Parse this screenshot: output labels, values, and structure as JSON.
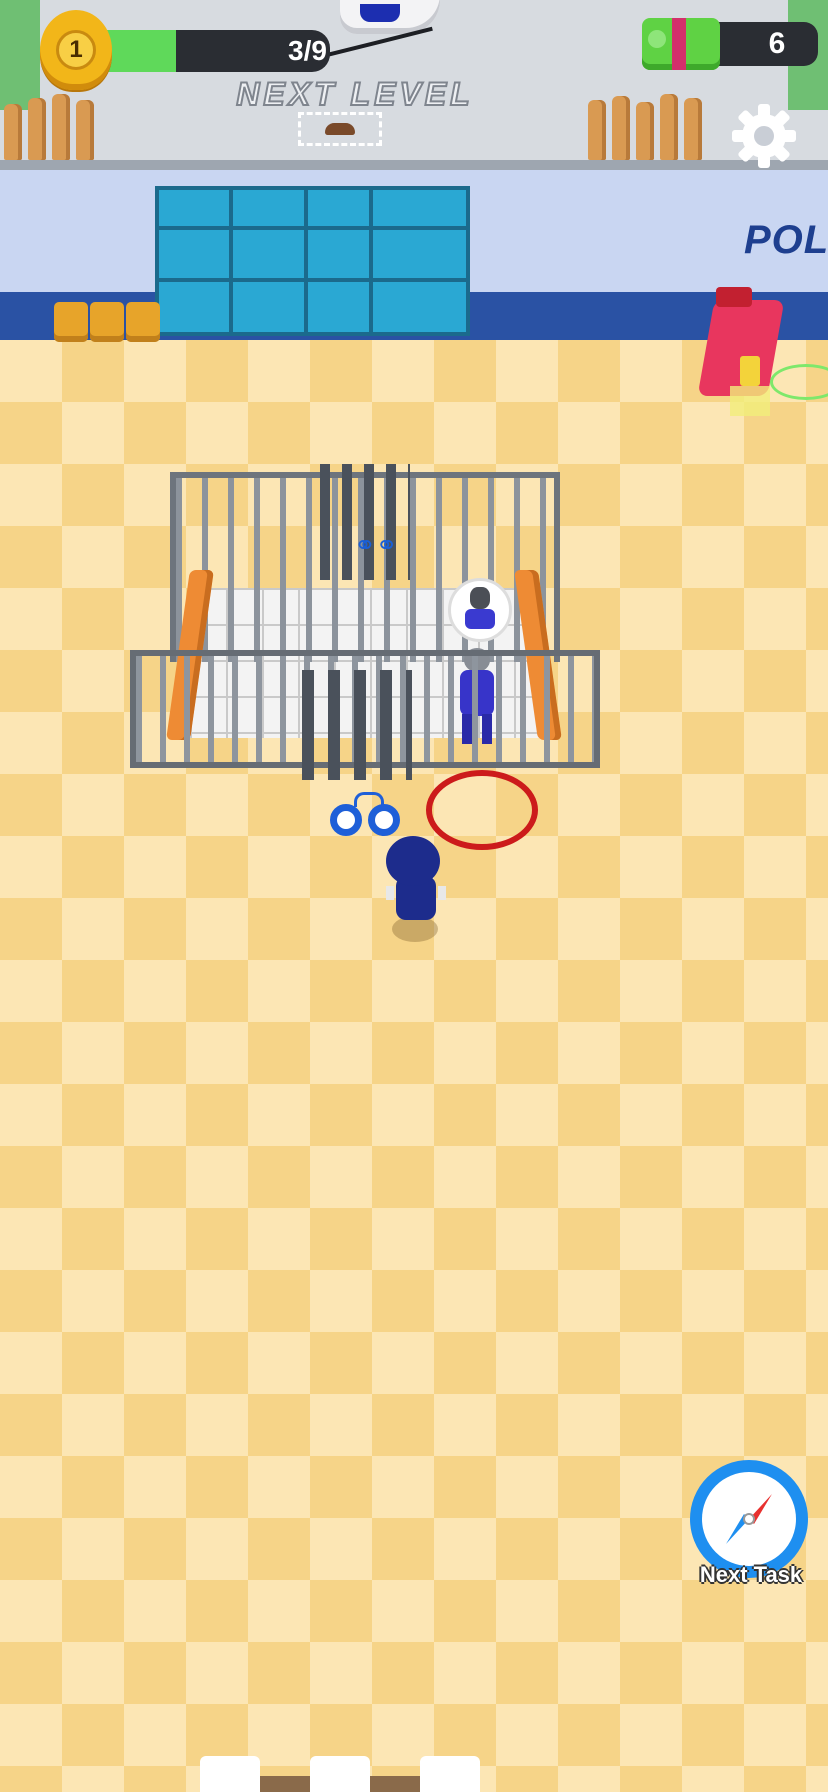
{
  "hud": {
    "level": "1",
    "progress_text": "3/9",
    "progress_value": 0.33,
    "cash": "6",
    "next_level_label": "NEXT LEVEL"
  },
  "scene": {
    "wall_sign": "POL"
  },
  "buttons": {
    "next_task_label": "Next Task"
  },
  "colors": {
    "progress_fill": "#5fd95a",
    "target_ring": "#cc1b1b",
    "cuffs": "#1e5fd8",
    "compass": "#1e8ff0"
  },
  "icons": [
    "level-badge-icon",
    "cash-icon",
    "gear-icon",
    "handcuffs-icon",
    "compass-icon",
    "helicopter-icon",
    "hat-icon"
  ]
}
